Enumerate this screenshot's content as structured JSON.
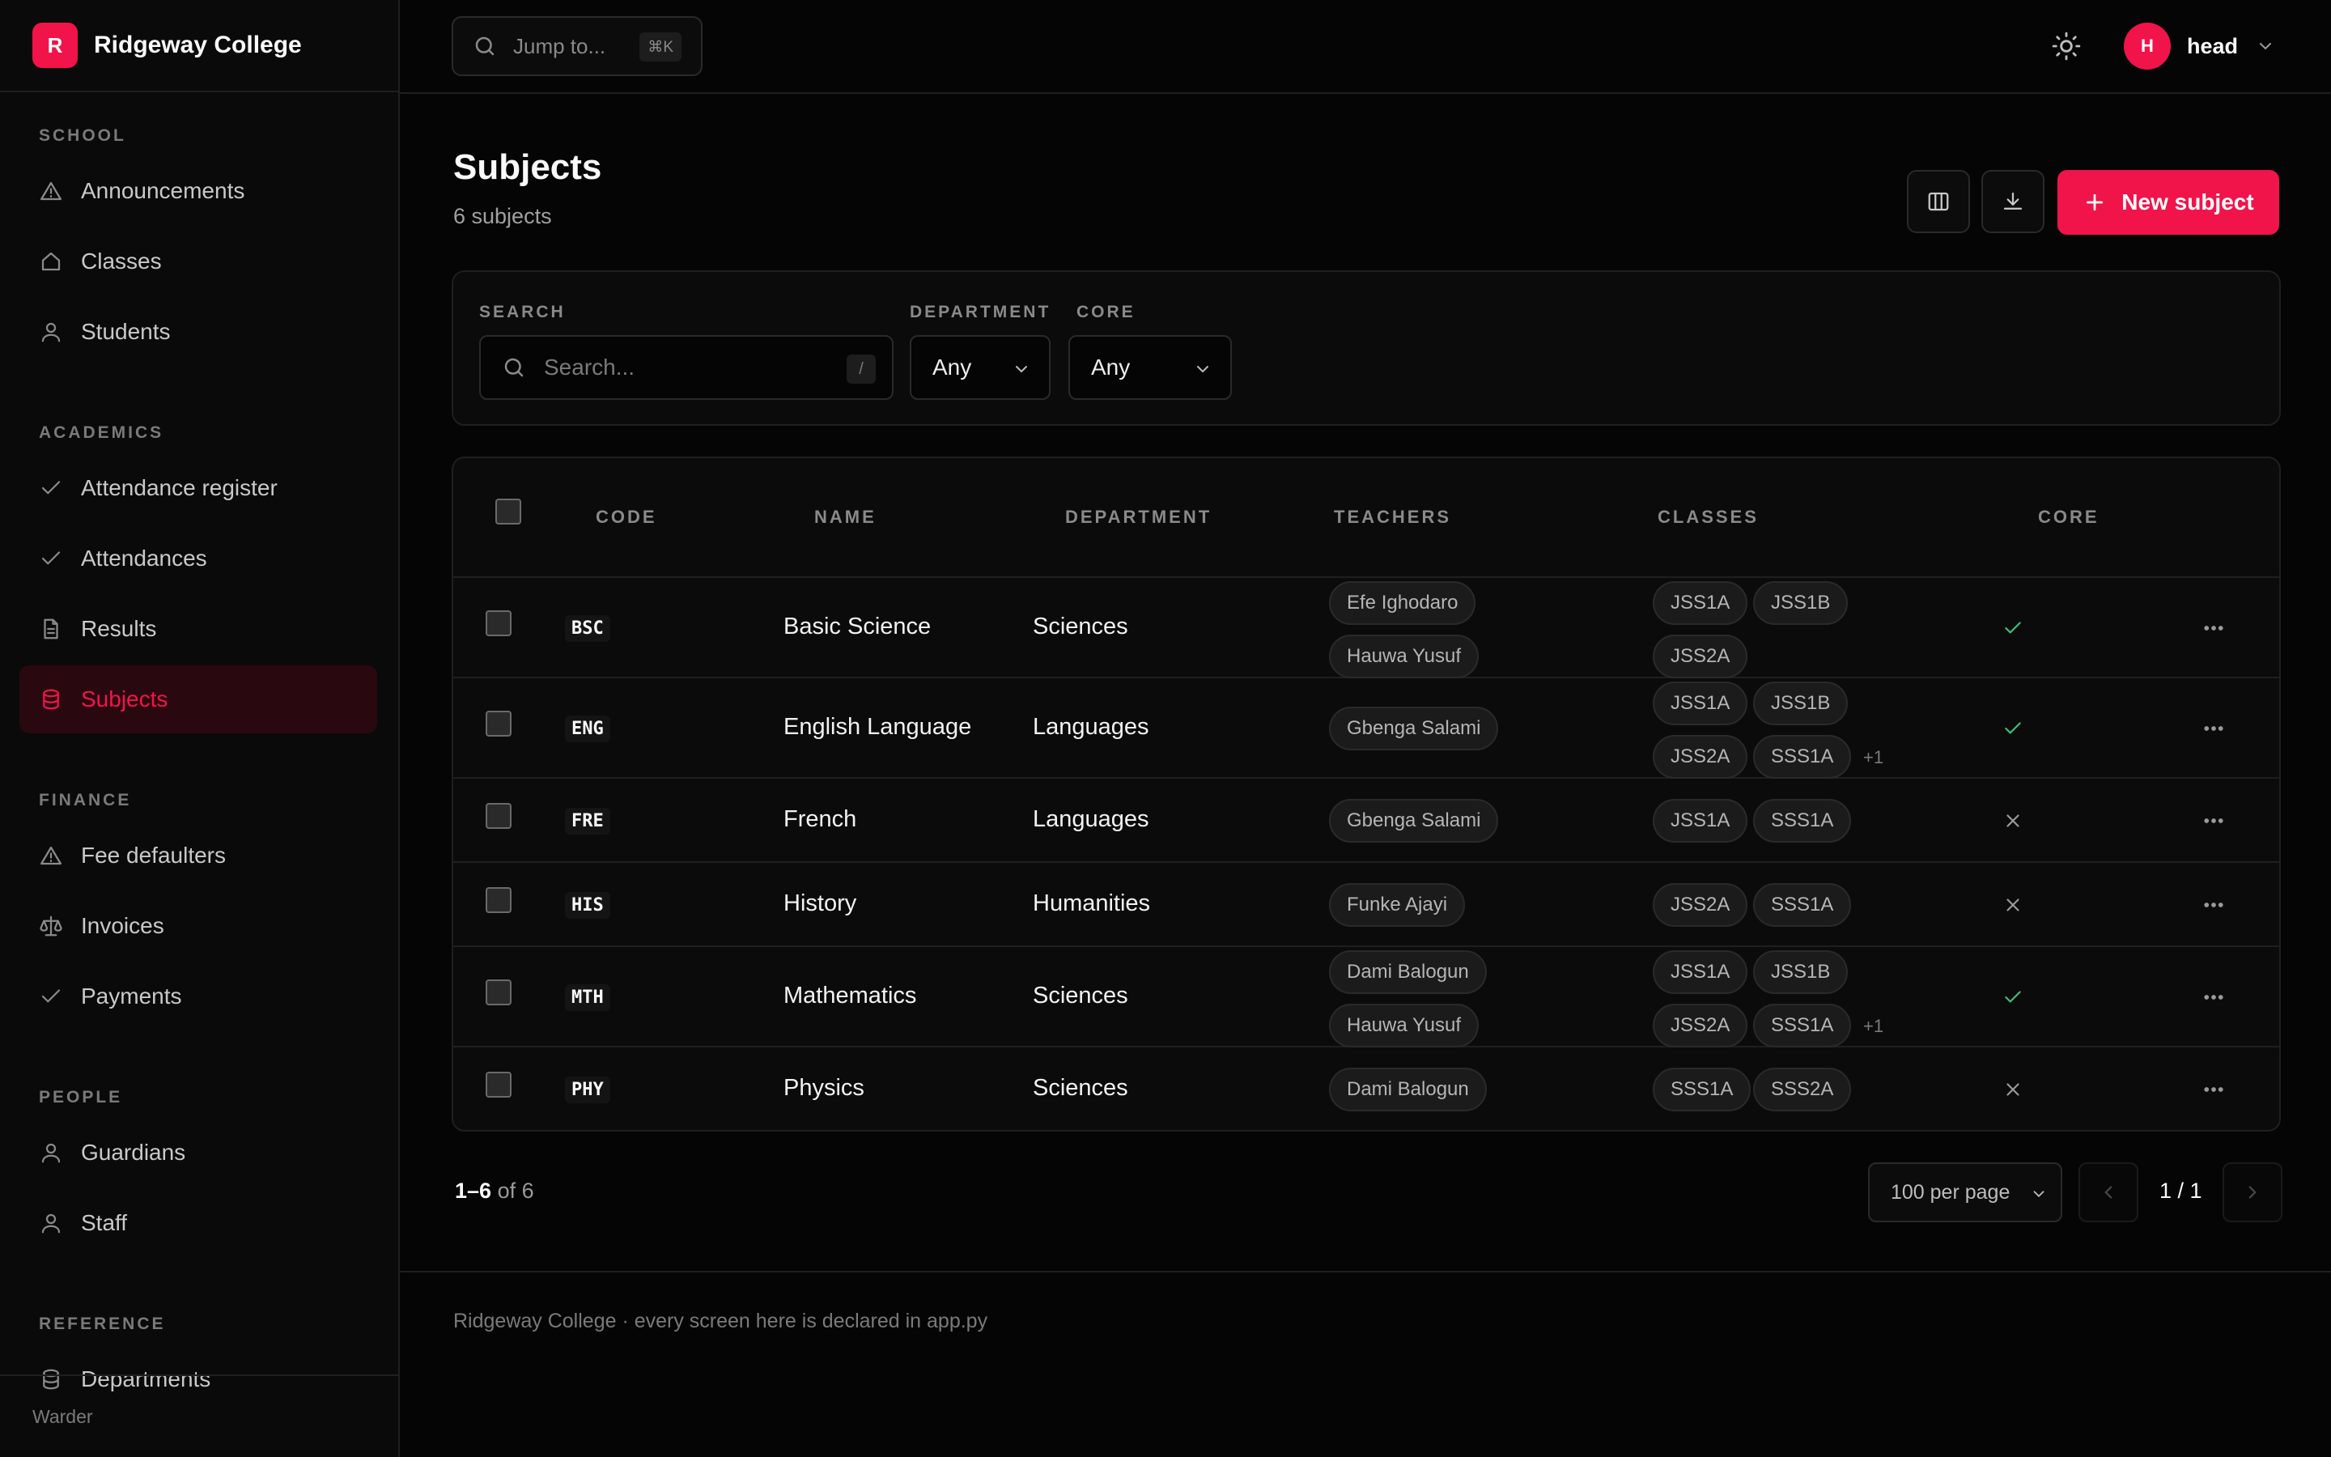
{
  "brand": {
    "logo_letter": "R",
    "name": "Ridgeway College",
    "accent": "#f0144a"
  },
  "sidebar": {
    "sections": [
      {
        "title": "SCHOOL",
        "items": [
          {
            "label": "Announcements",
            "icon": "alert-triangle-icon"
          },
          {
            "label": "Classes",
            "icon": "home-icon"
          },
          {
            "label": "Students",
            "icon": "user-icon"
          }
        ]
      },
      {
        "title": "ACADEMICS",
        "items": [
          {
            "label": "Attendance register",
            "icon": "check-icon"
          },
          {
            "label": "Attendances",
            "icon": "check-icon"
          },
          {
            "label": "Results",
            "icon": "document-icon"
          },
          {
            "label": "Subjects",
            "icon": "database-icon",
            "active": true
          }
        ]
      },
      {
        "title": "FINANCE",
        "items": [
          {
            "label": "Fee defaulters",
            "icon": "alert-triangle-icon"
          },
          {
            "label": "Invoices",
            "icon": "scale-icon"
          },
          {
            "label": "Payments",
            "icon": "check-icon"
          }
        ]
      },
      {
        "title": "PEOPLE",
        "items": [
          {
            "label": "Guardians",
            "icon": "user-icon"
          },
          {
            "label": "Staff",
            "icon": "user-icon"
          }
        ]
      },
      {
        "title": "REFERENCE",
        "items": [
          {
            "label": "Departments",
            "icon": "database-icon"
          }
        ]
      }
    ],
    "footer": "Warder"
  },
  "topbar": {
    "jump_placeholder": "Jump to...",
    "jump_shortcut": "⌘K",
    "user_initial": "H",
    "user_name": "head"
  },
  "page": {
    "title": "Subjects",
    "subtitle": "6 subjects",
    "new_button": "New subject"
  },
  "filters": {
    "search_label": "SEARCH",
    "search_placeholder": "Search...",
    "search_shortcut": "/",
    "department_label": "DEPARTMENT",
    "department_value": "Any",
    "core_label": "CORE",
    "core_value": "Any"
  },
  "table": {
    "columns": [
      "CODE",
      "NAME",
      "DEPARTMENT",
      "TEACHERS",
      "CLASSES",
      "CORE"
    ],
    "rows": [
      {
        "code": "BSC",
        "name": "Basic Science",
        "department": "Sciences",
        "teachers": [
          "Efe Ighodaro",
          "Hauwa Yusuf"
        ],
        "classes": [
          "JSS1A",
          "JSS1B",
          "JSS2A"
        ],
        "extra": "",
        "core": true
      },
      {
        "code": "ENG",
        "name": "English Language",
        "department": "Languages",
        "teachers": [
          "Gbenga Salami"
        ],
        "classes": [
          "JSS1A",
          "JSS1B",
          "JSS2A",
          "SSS1A"
        ],
        "extra": "+1",
        "core": true
      },
      {
        "code": "FRE",
        "name": "French",
        "department": "Languages",
        "teachers": [
          "Gbenga Salami"
        ],
        "classes": [
          "JSS1A",
          "SSS1A"
        ],
        "extra": "",
        "core": false
      },
      {
        "code": "HIS",
        "name": "History",
        "department": "Humanities",
        "teachers": [
          "Funke Ajayi"
        ],
        "classes": [
          "JSS2A",
          "SSS1A"
        ],
        "extra": "",
        "core": false
      },
      {
        "code": "MTH",
        "name": "Mathematics",
        "department": "Sciences",
        "teachers": [
          "Dami Balogun",
          "Hauwa Yusuf"
        ],
        "classes": [
          "JSS1A",
          "JSS1B",
          "JSS2A",
          "SSS1A"
        ],
        "extra": "+1",
        "core": true
      },
      {
        "code": "PHY",
        "name": "Physics",
        "department": "Sciences",
        "teachers": [
          "Dami Balogun"
        ],
        "classes": [
          "SSS1A",
          "SSS2A"
        ],
        "extra": "",
        "core": false
      }
    ]
  },
  "pagination": {
    "range": "1–6",
    "of_label": "of 6",
    "per_page": "100 per page",
    "page": "1 / 1"
  },
  "footer": {
    "text": "Ridgeway College · every screen here is declared in app.py"
  }
}
